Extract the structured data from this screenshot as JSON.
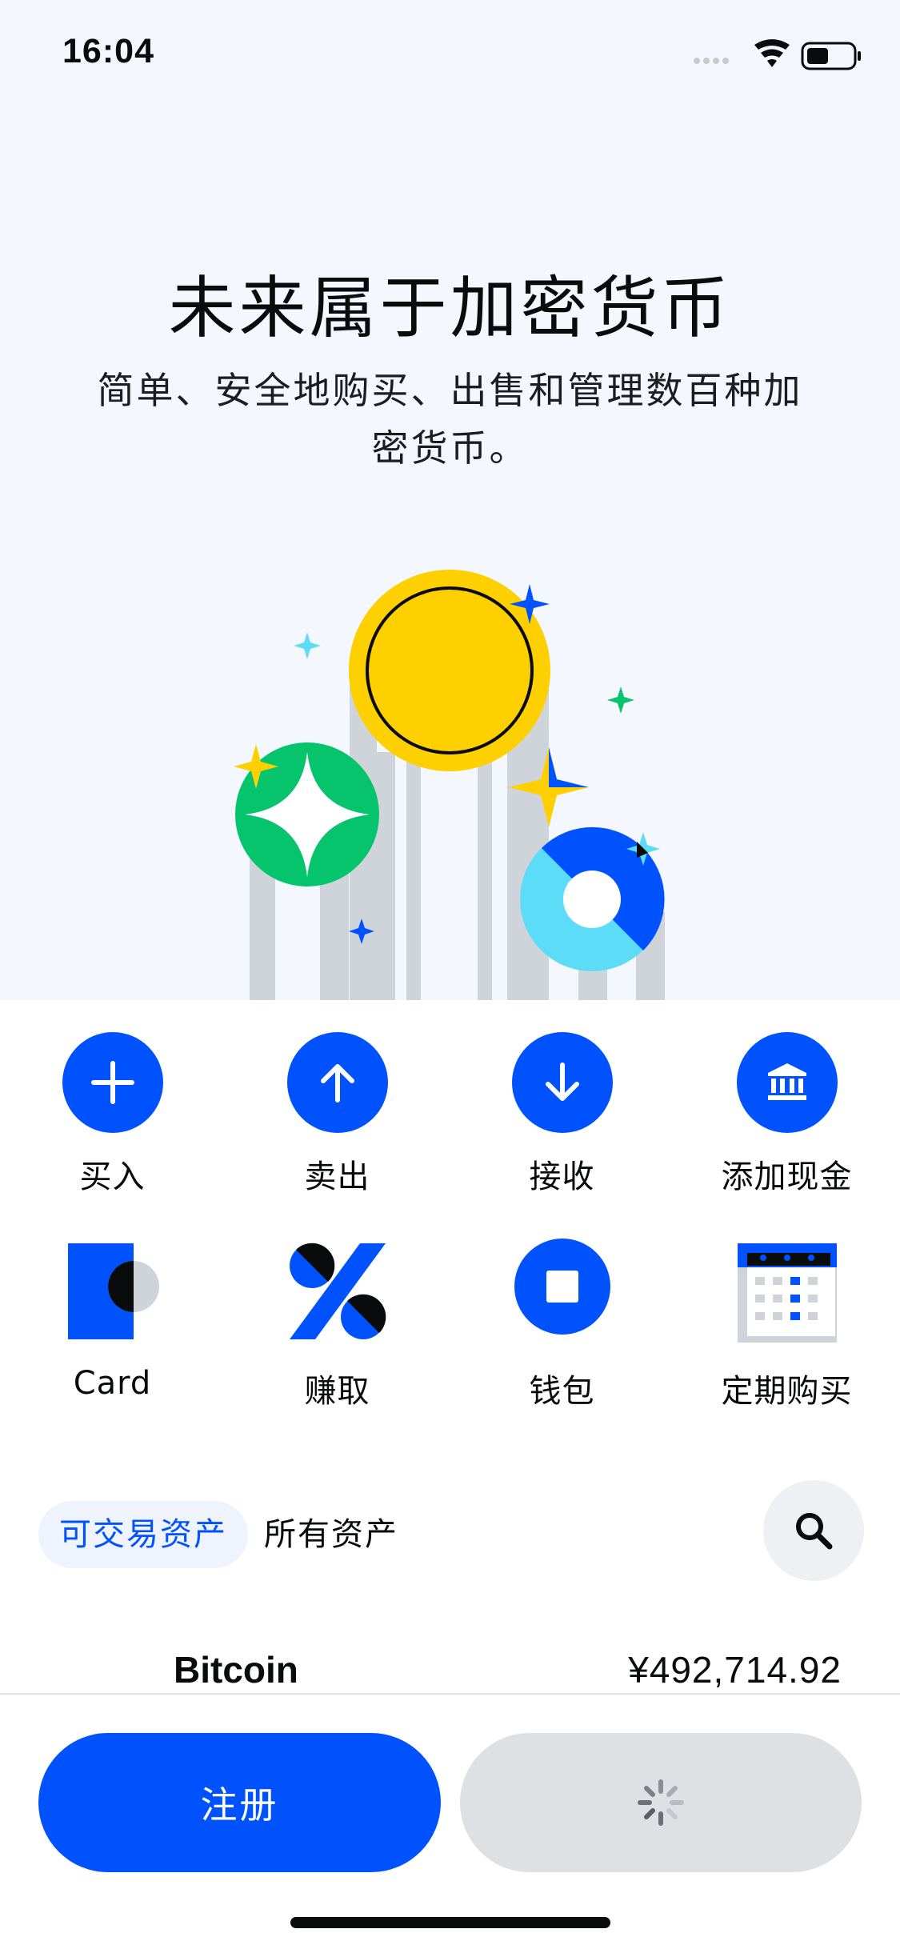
{
  "status_bar": {
    "time": "16:04"
  },
  "hero": {
    "title": "未来属于加密货币",
    "subtitle": "简单、安全地购买、出售和管理数百种加密货币。"
  },
  "actions": [
    {
      "label": "买入",
      "icon": "plus-icon"
    },
    {
      "label": "卖出",
      "icon": "arrow-up-icon"
    },
    {
      "label": "接收",
      "icon": "arrow-down-icon"
    },
    {
      "label": "添加现金",
      "icon": "bank-icon"
    },
    {
      "label": "Card",
      "icon": "card-icon"
    },
    {
      "label": "赚取",
      "icon": "percent-icon"
    },
    {
      "label": "钱包",
      "icon": "wallet-icon"
    },
    {
      "label": "定期购买",
      "icon": "calendar-icon"
    }
  ],
  "asset_tabs": {
    "active": "可交易资产",
    "inactive": "所有资产"
  },
  "asset_list": [
    {
      "name": "Bitcoin",
      "price": "¥492,714.92"
    }
  ],
  "buttons": {
    "signup": "注册"
  },
  "colors": {
    "brand_blue": "#0052ff",
    "hero_bg": "#f4f7fe",
    "coin_yellow": "#ffd000",
    "coin_green": "#05c46b",
    "coin_cyan": "#5ddcf8"
  }
}
